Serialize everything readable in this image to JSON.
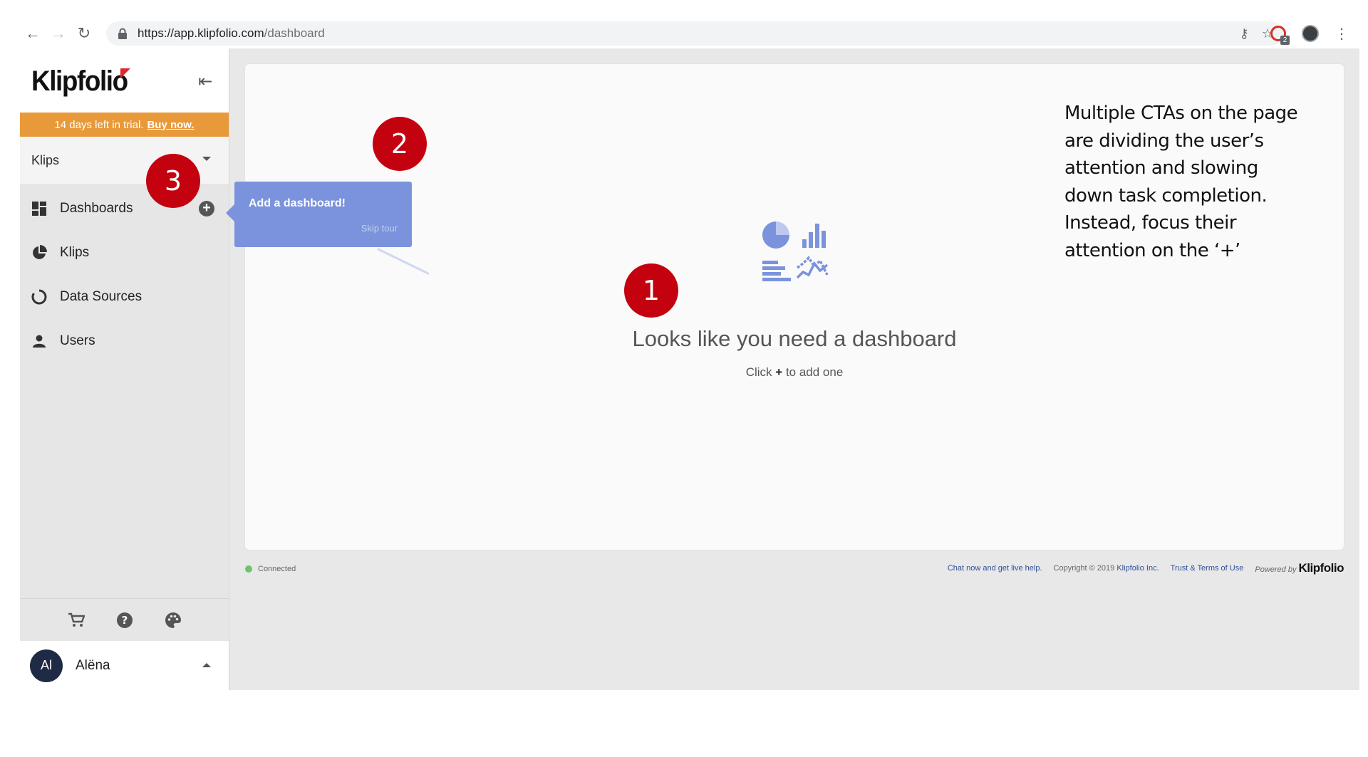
{
  "browser": {
    "url_host": "https://app.klipfolio.com",
    "url_path": "/dashboard",
    "extension_badge": "2"
  },
  "sidebar": {
    "logo": "Klipfolio",
    "trial_text": "14 days left in trial.",
    "trial_link": "Buy now.",
    "workspace": "Klips",
    "items": [
      {
        "label": "Dashboards",
        "icon": "dashboards-icon"
      },
      {
        "label": "Klips",
        "icon": "klips-icon"
      },
      {
        "label": "Data Sources",
        "icon": "data-sources-icon"
      },
      {
        "label": "Users",
        "icon": "user-icon"
      }
    ],
    "user": {
      "initials": "Al",
      "name": "Alëna"
    }
  },
  "main": {
    "empty_title": "Looks like you need a dashboard",
    "empty_sub_pre": "Click",
    "empty_sub_plus": "+",
    "empty_sub_post": "to add one"
  },
  "tooltip": {
    "title": "Add a dashboard!",
    "skip": "Skip tour"
  },
  "annotation": "Multiple CTAs on the page are dividing the user’s attention and slowing down task completion. Instead, focus their attention on the ‘+’",
  "steps": [
    "1",
    "2",
    "3"
  ],
  "footer": {
    "status": "Connected",
    "chat": "Chat now and get live help.",
    "copyright_pre": "Copyright © 2019",
    "copyright_link": "Klipfolio Inc.",
    "terms": "Trust & Terms of Use",
    "powered": "Powered by",
    "logo": "Klipfolio"
  },
  "colors": {
    "accent": "#7b93dc",
    "trial": "#e89a3a",
    "step": "#c4020f",
    "connected": "#6cc36c"
  }
}
